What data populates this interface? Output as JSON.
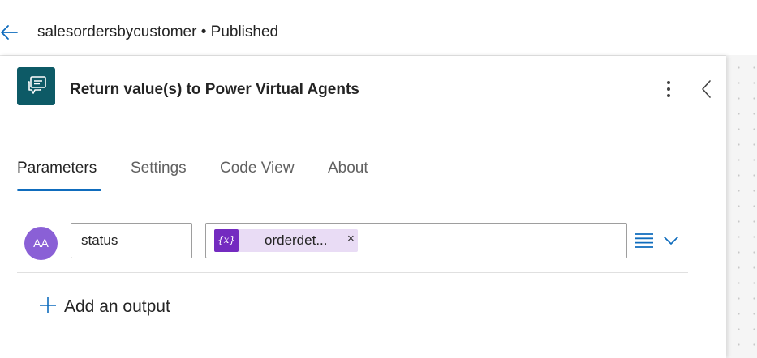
{
  "header": {
    "flow_name": "salesordersbycustomer",
    "separator": "•",
    "status": "Published",
    "back_icon": "arrow-left-icon"
  },
  "action": {
    "icon": "chat-bubble-icon",
    "title": "Return value(s) to Power Virtual Agents",
    "more_icon": "more-vertical-icon",
    "collapse_icon": "chevron-left-icon"
  },
  "tabs": [
    {
      "label": "Parameters",
      "active": true
    },
    {
      "label": "Settings",
      "active": false
    },
    {
      "label": "Code View",
      "active": false
    },
    {
      "label": "About",
      "active": false
    }
  ],
  "outputs": [
    {
      "type_badge": "AA",
      "name": "status",
      "value_token": {
        "icon_text": "{x}",
        "label": "orderdet...",
        "remove": "×"
      }
    }
  ],
  "add_output": {
    "label": "Add an output"
  },
  "colors": {
    "accent": "#0f6cbd",
    "action_icon_bg": "#0d5a66",
    "avatar_bg": "#8a60d6",
    "token_bg": "#e9dcf5",
    "token_icon_bg": "#742bc0"
  }
}
